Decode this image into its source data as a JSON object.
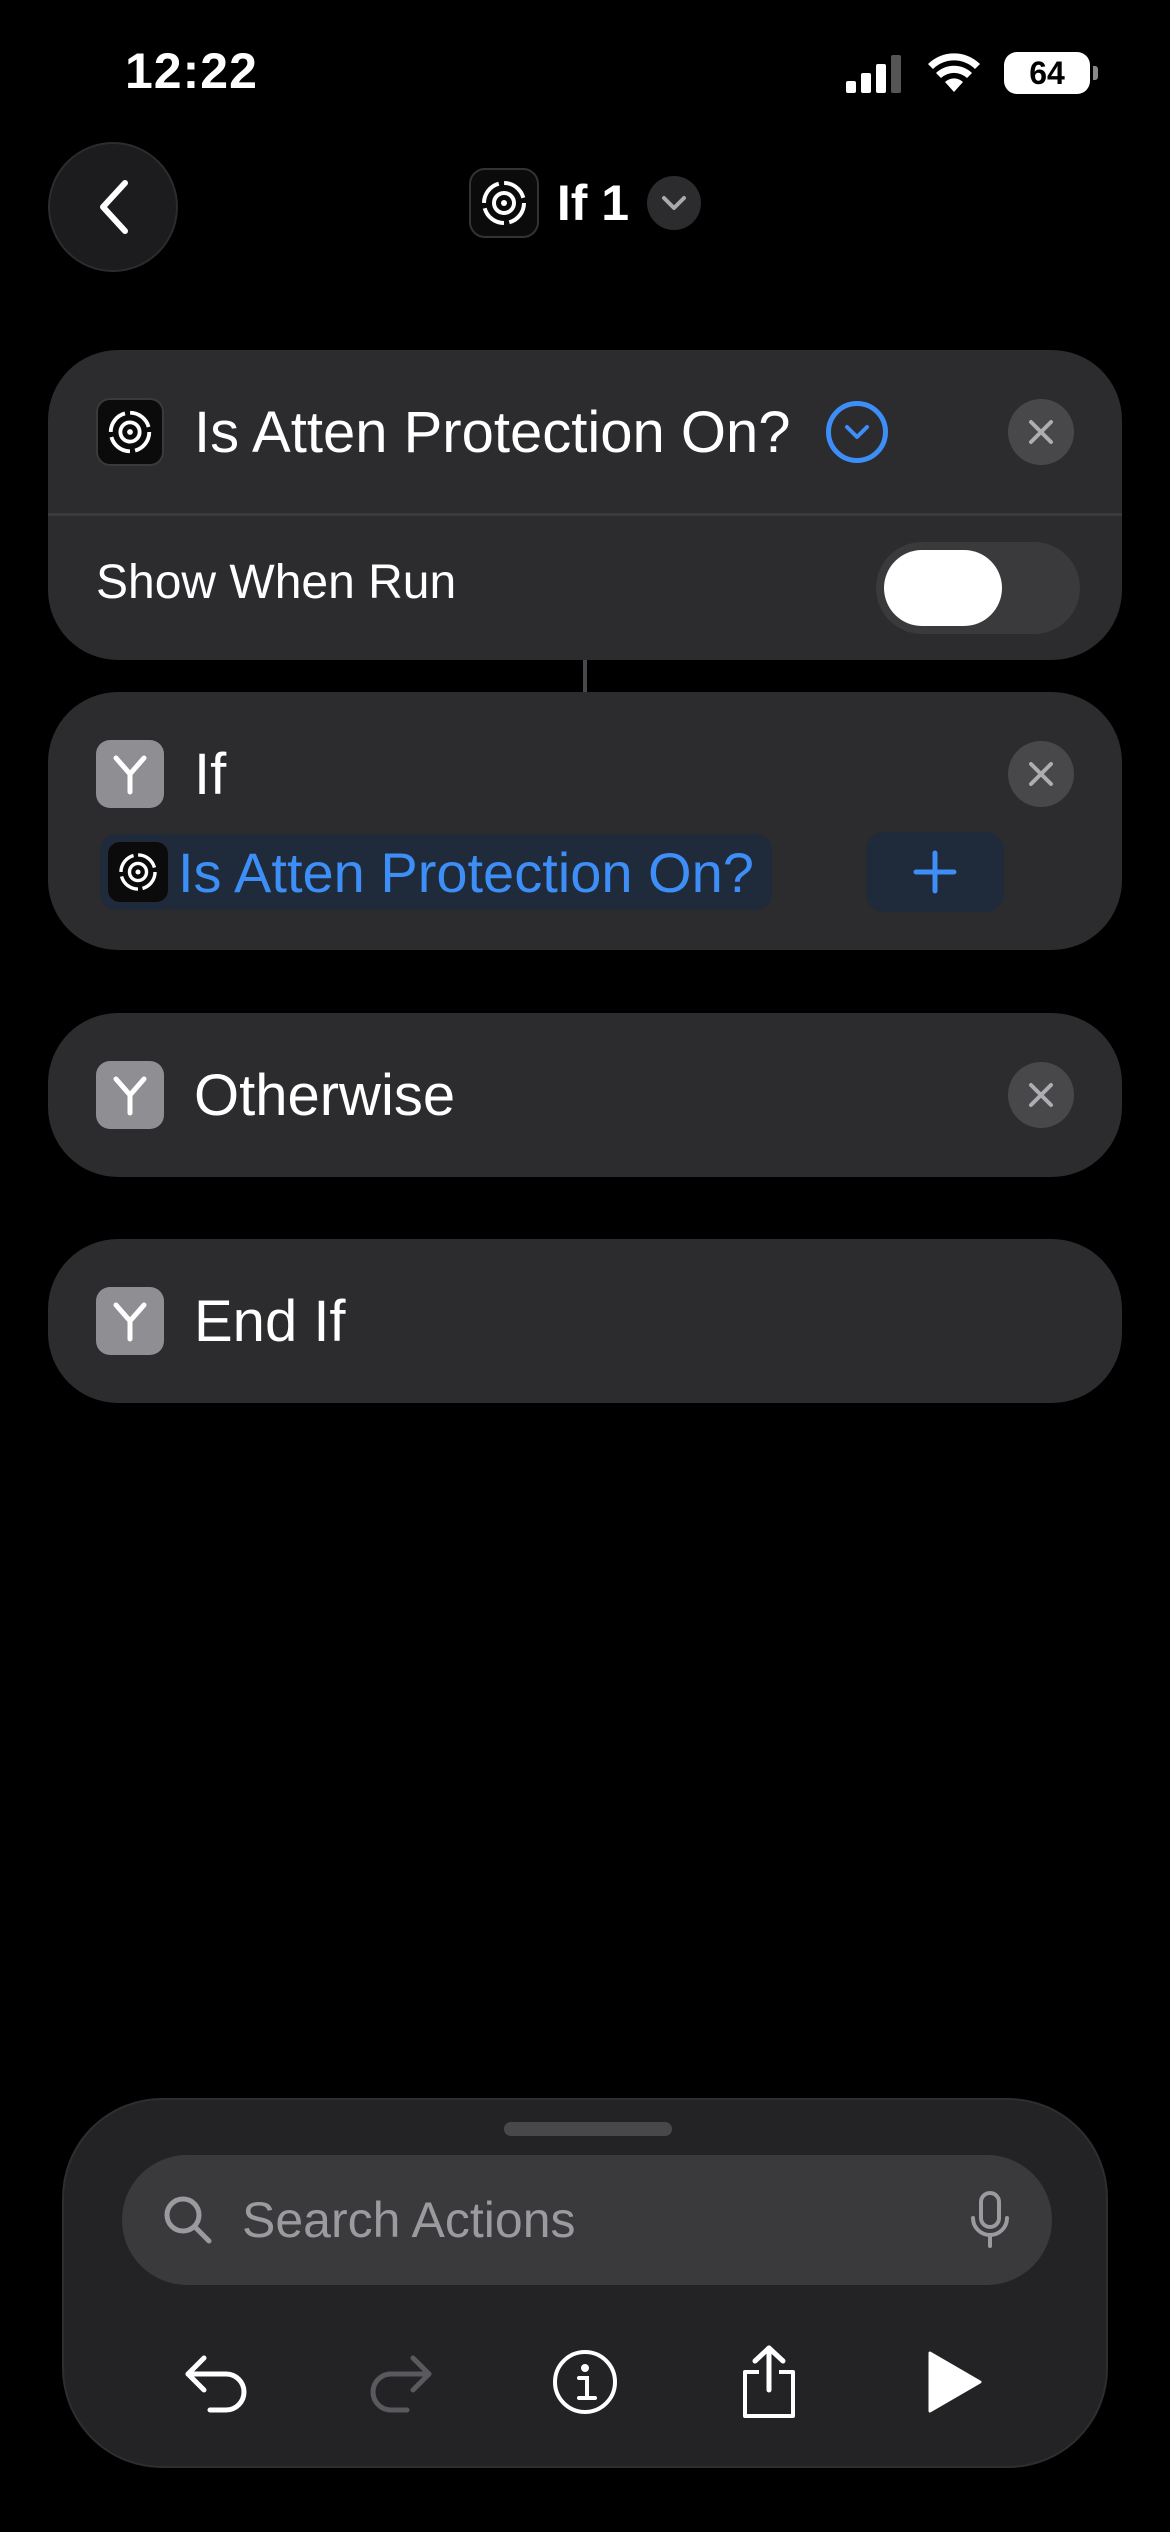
{
  "status_bar": {
    "time": "12:22",
    "battery": "64"
  },
  "nav": {
    "title": "If 1"
  },
  "action_card": {
    "title": "Is Atten Protection On?",
    "show_when_run_label": "Show When Run",
    "show_when_run_enabled": false
  },
  "if_card": {
    "title": "If",
    "condition_token": "Is Atten Protection On?"
  },
  "otherwise_card": {
    "title": "Otherwise"
  },
  "endif_card": {
    "title": "End If"
  },
  "search": {
    "placeholder": "Search Actions"
  },
  "colors": {
    "accent": "#3d8ef7",
    "card": "#2c2c2e",
    "background": "#000000",
    "branch_icon": "#8e8e93"
  }
}
